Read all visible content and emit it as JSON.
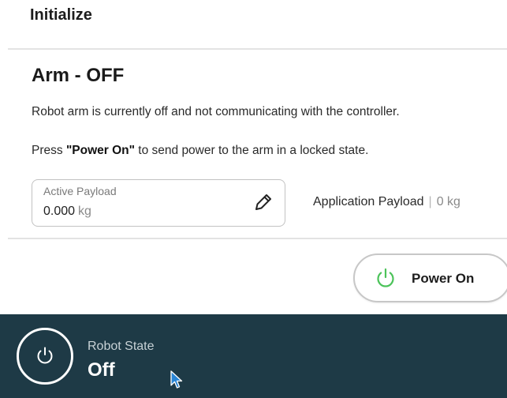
{
  "header": {
    "title": "Initialize"
  },
  "arm": {
    "title": "Arm - OFF",
    "description": "Robot arm is currently off and not communicating with the controller.",
    "instruction_prefix": "Press ",
    "instruction_bold": "\"Power On\"",
    "instruction_suffix": " to send power to the arm in a locked state."
  },
  "payload": {
    "label": "Active Payload",
    "value": "0.000",
    "unit": "kg",
    "edit_icon": "pencil-icon"
  },
  "application_payload": {
    "label": "Application Payload",
    "separator": "|",
    "value": "0 kg"
  },
  "power_button": {
    "label": "Power On",
    "icon": "power-icon",
    "icon_color": "#4cc35a"
  },
  "robot_state": {
    "label": "Robot State",
    "value": "Off",
    "icon": "power-icon",
    "background": "#1e3a46"
  }
}
